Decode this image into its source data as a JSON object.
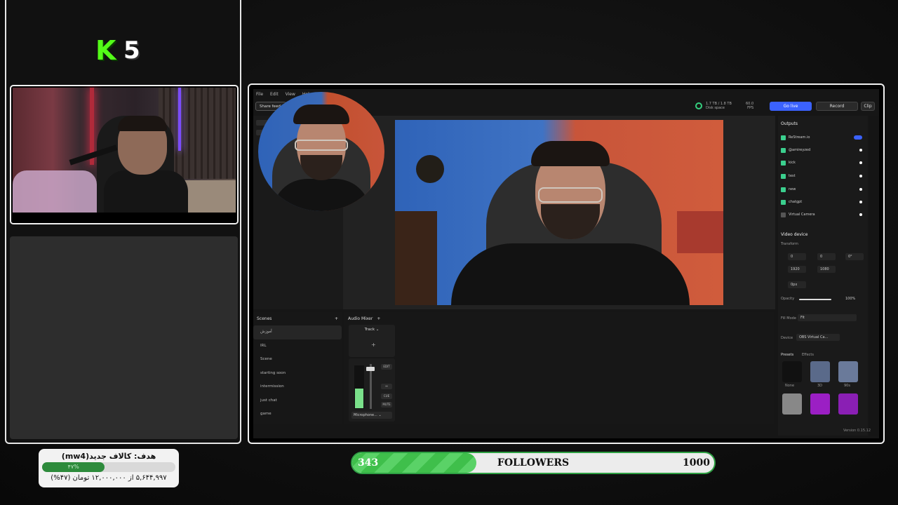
{
  "overlay": {
    "logo_letter": "K",
    "logo_number": "5",
    "goal": {
      "title": "هدف: کالاف جدید(mw4)",
      "percent_label": "۴۷%",
      "progress": 0.47,
      "amount": "۵,۶۴۴,۹۹۷ از ۱۲,۰۰۰,۰۰۰ تومان (۴۷%)"
    },
    "followers": {
      "count": "343",
      "label": "FOLLOWERS",
      "goal": "1000",
      "progress": 0.343
    }
  },
  "app": {
    "menu": [
      "File",
      "Edit",
      "View",
      "Help"
    ],
    "share_label": "Share feed",
    "disk_label": "1.7 TB / 1.8 TB",
    "disk_sub": "Disk space",
    "fps_value": "60.0",
    "fps_label": "FPS",
    "go_live": "Go live",
    "record": "Record",
    "clip": "Clip",
    "scenes_title": "Scenes",
    "scenes": [
      "آموزش",
      "IRL",
      "Scene",
      "starting soon",
      "intermission",
      "just chat",
      "game"
    ],
    "mixer_title": "Audio Mixer",
    "track_label": "Track",
    "edit_label": "EDIT",
    "cue_label": "CUE",
    "mute_label": "MUTE",
    "mic_label": "Microphone...",
    "outputs_title": "Outputs",
    "outputs": [
      {
        "name": "ReStream.io"
      },
      {
        "name": "@amireyzed"
      },
      {
        "name": "kick"
      },
      {
        "name": "test"
      },
      {
        "name": "new"
      },
      {
        "name": "chatgpt"
      },
      {
        "name": "Virtual Camera"
      }
    ],
    "video_device_title": "Video device",
    "transform_label": "Transform",
    "x_val": "0",
    "y_val": "0",
    "rot_val": "0°",
    "w_val": "1920",
    "h_val": "1080",
    "radius_val": "0px",
    "opacity_label": "Opacity",
    "opacity_val": "100%",
    "fill_mode_label": "Fill Mode",
    "fill_mode_val": "Fit",
    "device_label": "Device",
    "device_val": "OBS Virtual Ca...",
    "presets_tab": "Presets",
    "effects_tab": "Effects",
    "presets": [
      "None",
      "3D",
      "90s"
    ],
    "version": "Version 0.15.12"
  }
}
